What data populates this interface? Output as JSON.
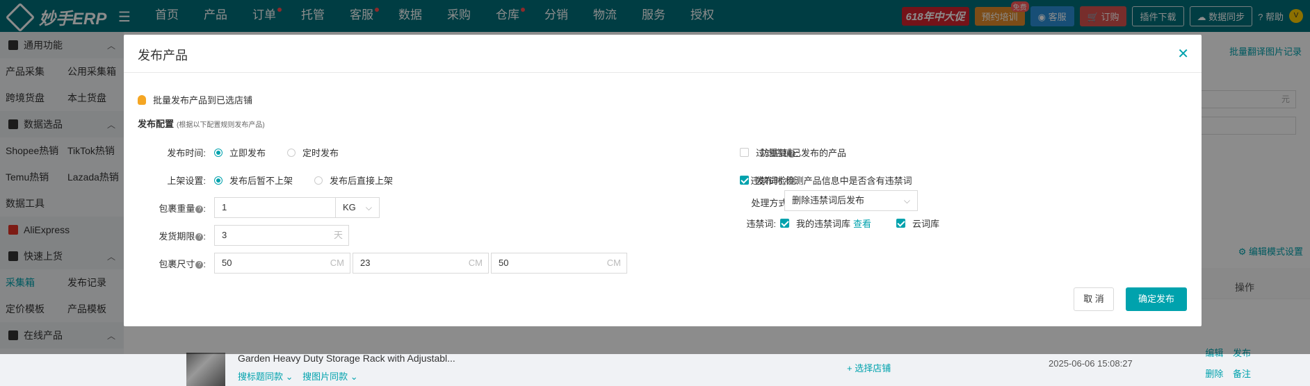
{
  "topbar": {
    "logo": "妙手ERP",
    "nav": [
      {
        "label": "首页",
        "dot": false
      },
      {
        "label": "产品",
        "dot": false
      },
      {
        "label": "订单",
        "dot": true
      },
      {
        "label": "托管",
        "dot": false
      },
      {
        "label": "客服",
        "dot": true
      },
      {
        "label": "数据",
        "dot": false
      },
      {
        "label": "采购",
        "dot": false
      },
      {
        "label": "仓库",
        "dot": true
      },
      {
        "label": "分销",
        "dot": false
      },
      {
        "label": "物流",
        "dot": false
      },
      {
        "label": "服务",
        "dot": false
      },
      {
        "label": "授权",
        "dot": false
      }
    ],
    "promo": "618年中大促",
    "training": "预约培训",
    "training_badge": "免费",
    "service": "客服",
    "order": "订购",
    "plugin": "插件下载",
    "sync": "数据同步",
    "help": "帮助"
  },
  "sidebar": {
    "sections": [
      {
        "title": "通用功能",
        "rows": [
          [
            "产品采集",
            "公用采集箱"
          ],
          [
            "跨境货盘",
            "本土货盘"
          ]
        ]
      },
      {
        "title": "数据选品",
        "rows": [
          [
            "Shopee热销",
            "TikTok热销"
          ],
          [
            "Temu热销",
            "Lazada热销"
          ],
          [
            "数据工具",
            ""
          ]
        ]
      },
      {
        "title": "AliExpress",
        "rows": []
      },
      {
        "title": "快速上货",
        "rows": [
          [
            "采集箱",
            "发布记录"
          ],
          [
            "定价模板",
            "产品模板"
          ]
        ]
      },
      {
        "title": "在线产品",
        "rows": []
      }
    ]
  },
  "background": {
    "translate_link": "批量翻译图片记录",
    "yuan": "元",
    "edit_mode": "编辑模式设置",
    "ops_header": "操作",
    "product_title": "Garden Heavy Duty Storage Rack with Adjustabl...",
    "search_title": "搜标题同款",
    "search_image": "搜图片同款",
    "choose_store": "+ 选择店铺",
    "date": "2025-06-06 15:08:27",
    "edit": "编辑",
    "publish": "发布",
    "delete": "删除",
    "note": "备注"
  },
  "modal": {
    "title": "发布产品",
    "tip": "批量发布产品到已选店铺",
    "config_title": "发布配置",
    "config_note": "(根据以下配置规则发布产品)",
    "publish_time_label": "发布时间:",
    "publish_now": "立即发布",
    "publish_scheduled": "定时发布",
    "shelf_label": "上架设置:",
    "shelf_off": "发布后暂不上架",
    "shelf_on": "发布后直接上架",
    "weight_label": "包裹重量",
    "weight_value": "1",
    "weight_unit": "KG",
    "ship_label": "发货期限",
    "ship_value": "3",
    "ship_unit": "天",
    "size_label": "包裹尺寸",
    "size_values": [
      "50",
      "23",
      "50"
    ],
    "size_unit": "CM",
    "dup_label": "防重复",
    "dup_text": "过滤店铺已发布的产品",
    "banned_label": "违禁词检测:",
    "banned_text": "发布时,检测产品信息中是否含有违禁词",
    "handle_label": "处理方式:",
    "handle_value": "删除违禁词后发布",
    "words_label": "违禁词:",
    "my_words": "我的违禁词库",
    "view": "查看",
    "cloud_words": "云词库",
    "cancel": "取 消",
    "confirm": "确定发布"
  }
}
